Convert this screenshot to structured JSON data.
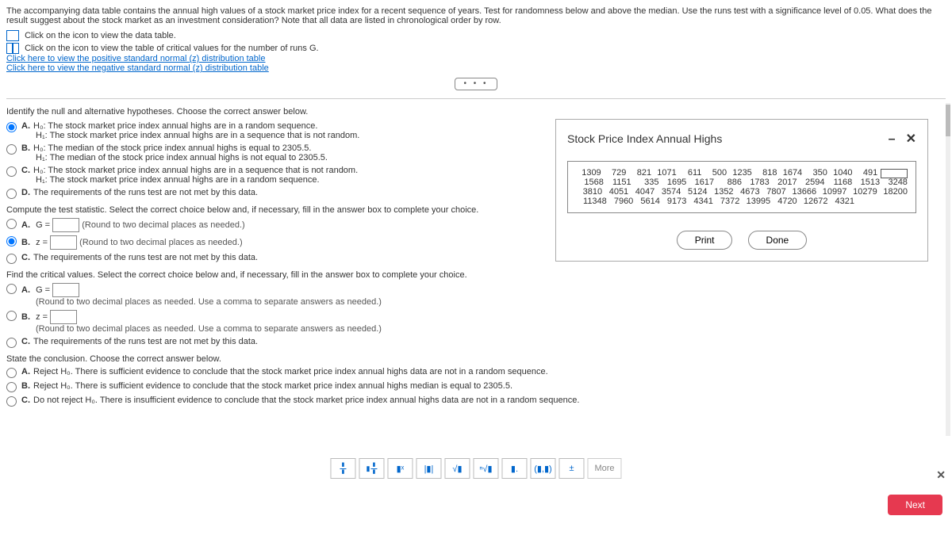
{
  "intro": {
    "text": "The accompanying data table contains the annual high values of a stock market price index for a recent sequence of years. Test for randomness below and above the median. Use the runs test with a significance level of 0.05. What does the result suggest about the stock market as an investment consideration? Note that all data are listed in chronological order by row.",
    "link_data": "Click on the icon to view the data table.",
    "link_critvals": "Click on the icon to view the table of critical values for the number of runs G.",
    "link_pos": "Click here to view the positive standard normal (z) distribution table",
    "link_neg": "Click here to view the negative standard normal (z) distribution table"
  },
  "q1": {
    "prompt": "Identify the null and alternative hypotheses. Choose the correct answer below.",
    "A_h0": "H₀: The stock market price index annual highs are in a random sequence.",
    "A_h1": "H₁: The stock market price index annual highs are in a sequence that is not random.",
    "B_h0": "H₀: The median of the stock price index annual highs is equal to 2305.5.",
    "B_h1": "H₁: The median of the stock price index annual highs is not equal to 2305.5.",
    "C_h0": "H₀: The stock market price index annual highs are in a sequence that is not random.",
    "C_h1": "H₁: The stock market price index annual highs are in a random sequence.",
    "D": "The requirements of the runs test are not met by this data."
  },
  "q2": {
    "prompt": "Compute the test statistic. Select the correct choice below and, if necessary, fill in the answer box to complete your choice.",
    "A_pre": "G =",
    "A_hint": "(Round to two decimal places as needed.)",
    "B_pre": "z =",
    "B_hint": "(Round to two decimal places as needed.)",
    "C": "The requirements of the runs test are not met by this data."
  },
  "q3": {
    "prompt": "Find the critical values. Select the correct choice below and, if necessary, fill in the answer box to complete your choice.",
    "A_pre": "G =",
    "A_hint": "(Round to two decimal places as needed. Use a comma to separate answers as needed.)",
    "B_pre": "z =",
    "B_hint": "(Round to two decimal places as needed. Use a comma to separate answers as needed.)",
    "C": "The requirements of the runs test are not met by this data."
  },
  "q4": {
    "prompt": "State the conclusion. Choose the correct answer below.",
    "A": "Reject H₀. There is sufficient evidence to conclude that the stock market price index annual highs data are not in a random sequence.",
    "B": "Reject H₀. There is sufficient evidence to conclude that the stock market price index annual highs median is equal to 2305.5.",
    "C": "Do not reject H₀. There is insufficient evidence to conclude that the stock market price index annual highs data are not in a random sequence."
  },
  "modal": {
    "title": "Stock Price Index Annual Highs",
    "rows": [
      [
        "1309",
        "729",
        "821",
        "1071",
        "611",
        "500",
        "1235",
        "818",
        "1674",
        "350",
        "1040",
        "491"
      ],
      [
        "1568",
        "1151",
        "335",
        "1695",
        "1617",
        "886",
        "1783",
        "2017",
        "2594",
        "1168",
        "1513",
        "3248"
      ],
      [
        "3810",
        "4051",
        "4047",
        "3574",
        "5124",
        "1352",
        "4673",
        "7807",
        "13666",
        "10997",
        "10279",
        "18200"
      ],
      [
        "11348",
        "7960",
        "5614",
        "9173",
        "4341",
        "7372",
        "13995",
        "4720",
        "12672",
        "4321",
        "",
        ""
      ]
    ],
    "print": "Print",
    "done": "Done"
  },
  "toolbar": {
    "more": "More",
    "plusminus": "±",
    "paren": "(▮,▮)",
    "dot": "▮.",
    "sqrt": "√▮",
    "nsqrt": "ⁿ√▮",
    "abs": "|▮|",
    "expo": "▮ˣ"
  },
  "footer": {
    "next": "Next"
  }
}
